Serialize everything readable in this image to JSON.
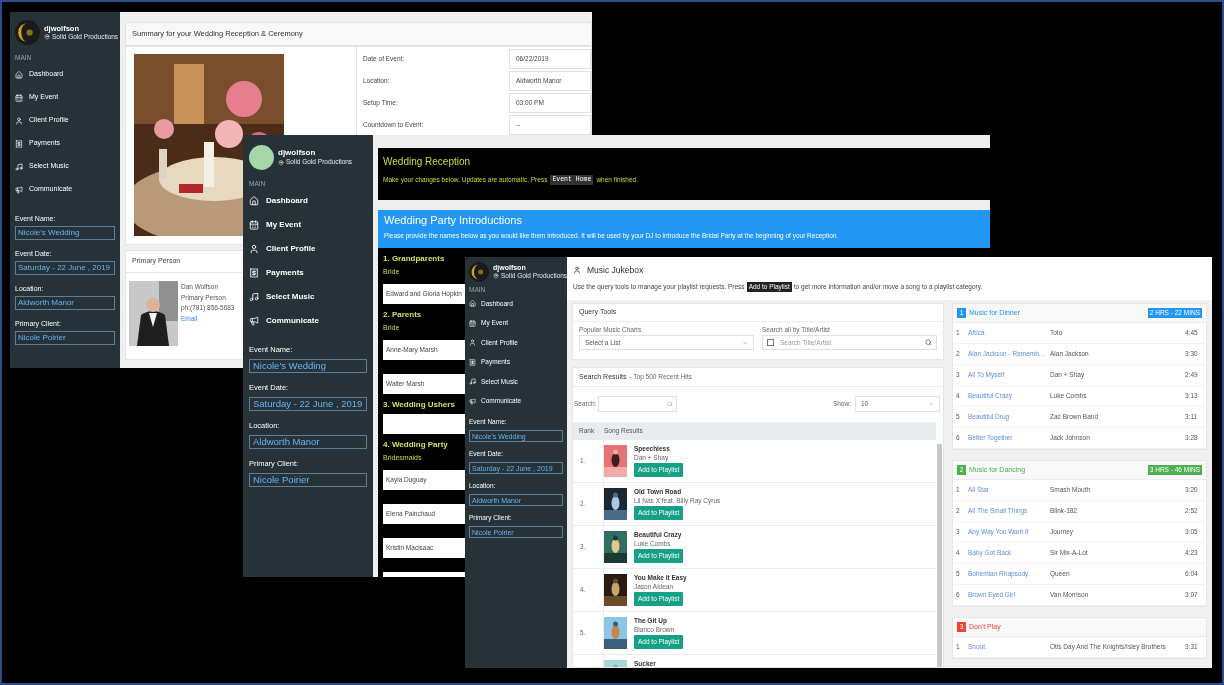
{
  "summary_window": {
    "sidebar": {
      "avatar": {
        "kind": "logo"
      },
      "user": "djwolfson",
      "company": "Solid Gold Productions",
      "section": "MAIN",
      "nav": [
        "Dashboard",
        "My Event",
        "Client Profile",
        "Payments",
        "Select Music",
        "Communicate"
      ],
      "fields": [
        {
          "label": "Event Name:",
          "value": "Nicole's Wedding"
        },
        {
          "label": "Event Date:",
          "value": "Saturday - 22 June , 2019"
        },
        {
          "label": "Location:",
          "value": "Aldworth Manor"
        },
        {
          "label": "Primary Client:",
          "value": "Nicole Poirier"
        }
      ]
    },
    "title": "Summary for your Wedding Reception & Ceremony",
    "details": [
      {
        "label": "Date of Event:",
        "value": "06/22/2019"
      },
      {
        "label": "Location:",
        "value": "Aldworth Manor"
      },
      {
        "label": "Setup Time:",
        "value": "03:00 PM"
      },
      {
        "label": "Countdown to Event:",
        "value": "--"
      }
    ],
    "primary_person": {
      "heading": "Primary Person",
      "name": "Dan Wolfson",
      "role": "Primary Person",
      "phone": "ph:(781) 856-5683",
      "link": "Email"
    }
  },
  "reception_window": {
    "sidebar": {
      "avatar": {
        "kind": "plain"
      },
      "user": "djwolfson",
      "company": "Solid Gold Productions",
      "section": "MAIN",
      "nav": [
        "Dashboard",
        "My Event",
        "Client Profile",
        "Payments",
        "Select Music",
        "Communicate"
      ],
      "fields": [
        {
          "label": "Event Name:",
          "value": "Nicole's Wedding"
        },
        {
          "label": "Event Date:",
          "value": "Saturday - 22 June , 2019"
        },
        {
          "label": "Location:",
          "value": "Aldworth Manor"
        },
        {
          "label": "Primary Client:",
          "value": "Nicole Poirier"
        }
      ]
    },
    "title": "Wedding Reception",
    "note_before": "Make your changes below. Updates are automatic. Press",
    "note_code": "Event Home",
    "note_after": "when finished.",
    "intro_title": "Wedding Party Introductions",
    "intro_text": "Please provide the names below as you would like them introduced. It will be used by your DJ to introduce the Bridal Party at the beginning of your Reception.",
    "groups": [
      {
        "title": "1. Grandparents",
        "label": "Bride",
        "inputs": [
          {
            "kind": "name",
            "value": "Edward and Gloria Hopkin"
          }
        ]
      },
      {
        "title": "2. Parents",
        "label": "Bride",
        "inputs": [
          {
            "kind": "name",
            "value": "Anne-Mary Marsh"
          },
          {
            "kind": "name",
            "value": "Walter Marsh"
          }
        ]
      },
      {
        "title": "3. Wedding Ushers",
        "inputs": [
          {
            "kind": "blank"
          }
        ]
      },
      {
        "title": "4. Wedding Party",
        "label": "Bridesmaids",
        "inputs": [
          {
            "kind": "name",
            "value": "Kayla Duguay"
          },
          {
            "kind": "name",
            "value": "Elena Painchaud"
          },
          {
            "kind": "name",
            "value": "Kristin Macisaac"
          },
          {
            "kind": "blank"
          }
        ]
      }
    ]
  },
  "jukebox_window": {
    "sidebar": {
      "avatar": {
        "kind": "logo"
      },
      "user": "djwolfson",
      "company": "Solid Gold Productions",
      "section": "MAIN",
      "nav": [
        "Dashboard",
        "My Event",
        "Client Profile",
        "Payments",
        "Select Music",
        "Communicate"
      ],
      "fields": [
        {
          "label": "Event Name:",
          "value": "Nicole's Wedding"
        },
        {
          "label": "Event Date:",
          "value": "Saturday - 22 June , 2019"
        },
        {
          "label": "Location:",
          "value": "Aldworth Manor"
        },
        {
          "label": "Primary Client:",
          "value": "Nicole Poirier"
        }
      ]
    },
    "title": "Music Jukebox",
    "desc_before": "Use the query tools to manage your playlist requests. Press",
    "desc_badge": "Add to Playlist",
    "desc_after": "to get more information and/or move a song to a playlist category.",
    "query_tools": {
      "title": "Query Tools",
      "charts_label": "Popular Music Charts",
      "select_placeholder": "Select a List",
      "search_label": "Search all by Title/Artist",
      "search_placeholder": "Search Title/Artist",
      "checked": false
    },
    "search_results": {
      "title": "Search Results",
      "subtitle": "- Top 500 Recent Hits",
      "search_label": "Search:",
      "show_label": "Show:",
      "show_value": "10",
      "columns": [
        "Rank",
        "Song Results"
      ],
      "rows": [
        {
          "rank": "1.",
          "title": "Speechless",
          "artist": "Dan + Shay",
          "button": "Add to Playlist"
        },
        {
          "rank": "2.",
          "title": "Old Town Road",
          "artist": "Lil Nas X feat. Billy Ray Cyrus",
          "button": "Add to Playlist"
        },
        {
          "rank": "3.",
          "title": "Beautiful Crazy",
          "artist": "Luke Combs",
          "button": "Add to Playlist"
        },
        {
          "rank": "4.",
          "title": "You Make It Easy",
          "artist": "Jason Aldean",
          "button": "Add to Playlist"
        },
        {
          "rank": "5.",
          "title": "The Git Up",
          "artist": "Blanco Brown",
          "button": "Add to Playlist"
        },
        {
          "title": "Sucker"
        }
      ]
    },
    "playlists": [
      {
        "number": "1",
        "title": "Music for Dinner",
        "color": "#2196f3",
        "duration": "2 HRS - 22 MINS",
        "songs": [
          {
            "n": "1",
            "title": "Africa",
            "artist": "Toto",
            "time": "4:45"
          },
          {
            "n": "2",
            "title": "Alan Jackson - Rememb...",
            "artist": "Alan Jackson",
            "time": "3:30"
          },
          {
            "n": "3",
            "title": "All To Myself",
            "artist": "Dan + Shay",
            "time": "2:49"
          },
          {
            "n": "4",
            "title": "Beautiful Crazy",
            "artist": "Luke Combs",
            "time": "3:13"
          },
          {
            "n": "5",
            "title": "Beautiful Drug",
            "artist": "Zac Brown Band",
            "time": "3:11"
          },
          {
            "n": "6",
            "title": "Better Together",
            "artist": "Jack Johnson",
            "time": "3:28"
          }
        ]
      },
      {
        "number": "2",
        "title": "Music for Dancing",
        "color": "#4caf50",
        "duration": "3 HRS - 46 MINS",
        "songs": [
          {
            "n": "1",
            "title": "All Star",
            "artist": "Smash Mouth",
            "time": "3:20"
          },
          {
            "n": "2",
            "title": "All The Small Things",
            "artist": "Blink-182",
            "time": "2:52"
          },
          {
            "n": "3",
            "title": "Any Way You Want It",
            "artist": "Journey",
            "time": "3:05"
          },
          {
            "n": "4",
            "title": "Baby Got Back",
            "artist": "Sir Mix-A-Lot",
            "time": "4:23"
          },
          {
            "n": "5",
            "title": "Bohemian Rhapsody",
            "artist": "Queen",
            "time": "6:04"
          },
          {
            "n": "6",
            "title": "Brown Eyed Girl",
            "artist": "Van Morrison",
            "time": "3:07"
          }
        ]
      },
      {
        "number": "3",
        "title": "Don't Play",
        "color": "#f44336",
        "songs": [
          {
            "n": "1",
            "title": "Shout",
            "artist": "Otis Day And The Knights/Isley Brothers",
            "time": "3:31"
          }
        ]
      }
    ]
  }
}
